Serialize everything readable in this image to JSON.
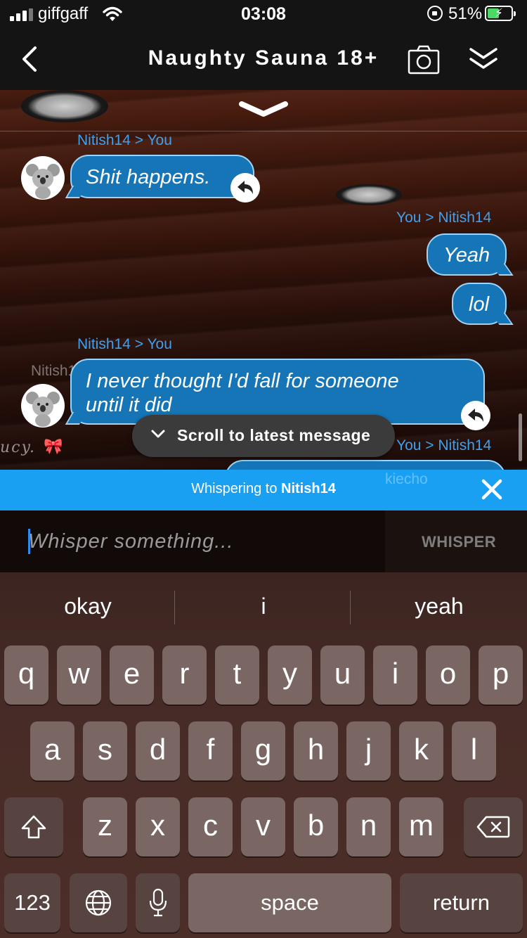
{
  "status": {
    "carrier": "giffgaff",
    "time": "03:08",
    "battery_pct": "51%",
    "battery_level": 0.51,
    "charging": true,
    "signal_bars": 3
  },
  "header": {
    "title": "Naughty Sauna 18+",
    "icons": [
      "back-chevron-icon",
      "camera-icon",
      "collapse-double-chevron-icon"
    ]
  },
  "messages": [
    {
      "from": "Nitish14",
      "to": "You",
      "arrow": ">",
      "text": "Shit happens.",
      "side": "left"
    },
    {
      "from": "You",
      "to": "Nitish14",
      "arrow": ">",
      "text": "Yeah",
      "side": "right"
    },
    {
      "from": "",
      "to": "",
      "text": "lol",
      "side": "right"
    },
    {
      "from": "Nitish14",
      "to": "You",
      "arrow": ">",
      "text_line1": "I never thought I'd fall for someone",
      "text_line2": "until it did",
      "side": "left"
    },
    {
      "from": "You",
      "to": "Nitish14",
      "arrow": ">",
      "text": "",
      "side": "right"
    }
  ],
  "background_ghost": {
    "name": "Nitish14",
    "script": "ucy.",
    "bow": "🎀",
    "kiecho": "kiecho"
  },
  "scroll_pill": {
    "label": "Scroll to latest message"
  },
  "whisper": {
    "prefix": "Whispering to",
    "target": "Nitish14",
    "placeholder": "Whisper something...",
    "send_label": "WHISPER"
  },
  "keyboard": {
    "suggestions": [
      "okay",
      "i",
      "yeah"
    ],
    "row1": [
      "q",
      "w",
      "e",
      "r",
      "t",
      "y",
      "u",
      "i",
      "o",
      "p"
    ],
    "row2": [
      "a",
      "s",
      "d",
      "f",
      "g",
      "h",
      "j",
      "k",
      "l"
    ],
    "row3": [
      "z",
      "x",
      "c",
      "v",
      "b",
      "n",
      "m"
    ],
    "numbers_label": "123",
    "space_label": "space",
    "return_label": "return"
  },
  "colors": {
    "accent": "#1aa0f2",
    "bubble": "#1575b7",
    "bubble_border": "#9fd4f7",
    "sender_label": "#3ea0ee"
  }
}
